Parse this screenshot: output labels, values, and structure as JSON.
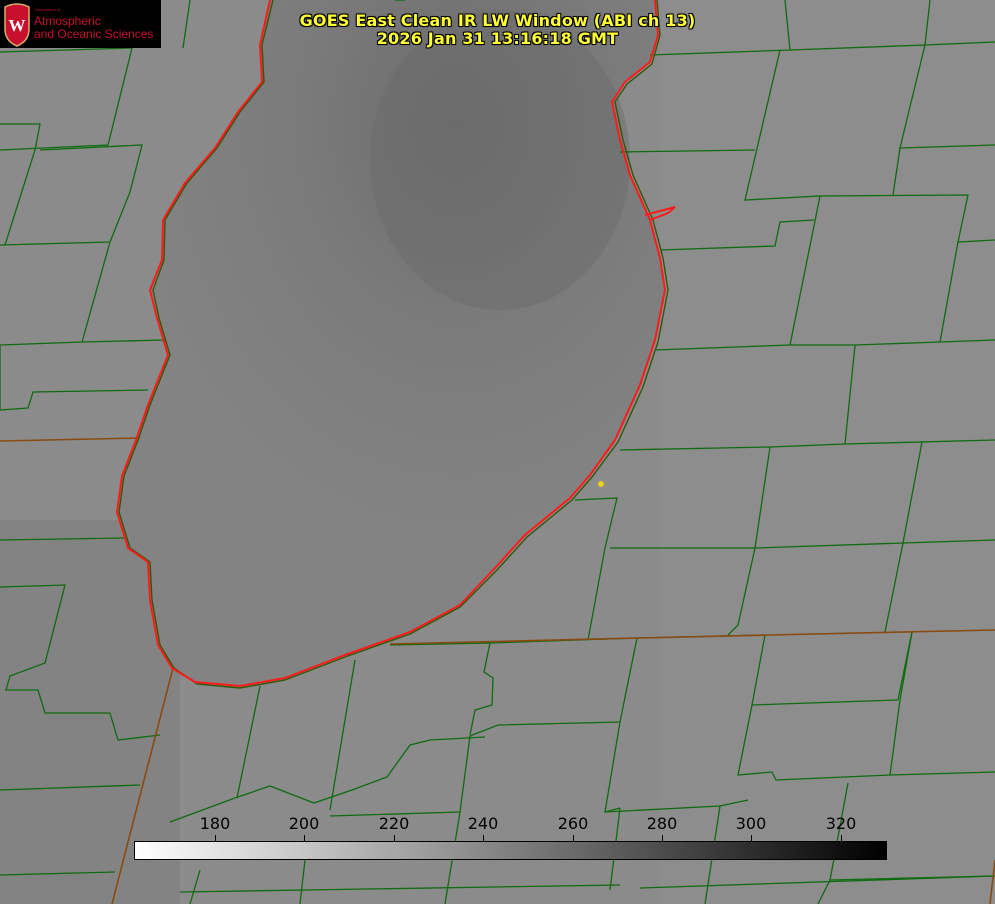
{
  "title": {
    "line1": "GOES East Clean IR LW Window (ABI ch 13)",
    "line2": "2026 Jan 31 13:16:18 GMT"
  },
  "logo": {
    "dept": "Department of",
    "line1": "Atmospheric",
    "line2": "and Oceanic Sciences",
    "crest_letter": "W"
  },
  "colorbar": {
    "tick_labels": [
      "180",
      "200",
      "220",
      "240",
      "260",
      "280",
      "300",
      "320"
    ],
    "gradient_from": "#ffffff",
    "gradient_to": "#000000"
  },
  "colors": {
    "lake_outline": "#ff1a1a",
    "county_lines": "#0f6b0f",
    "state_lines": "#8a4a10",
    "title_text": "#ffff33",
    "marker": "#e6d21a",
    "logo_red": "#c8102e"
  }
}
